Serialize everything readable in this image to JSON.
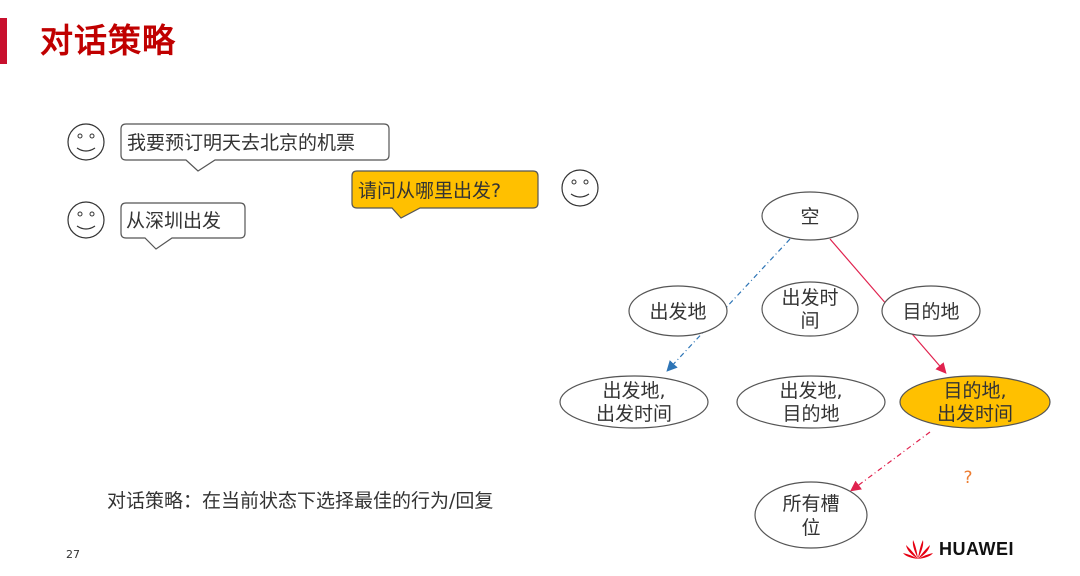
{
  "slide": {
    "title": "对话策略",
    "caption": "对话策略：在当前状态下选择最佳的行为/回复",
    "page_number": "27",
    "brand": "HUAWEI"
  },
  "dialogue": {
    "user_1": "我要预订明天去北京的机票",
    "system_1": "请问从哪里出发?",
    "user_2": "从深圳出发"
  },
  "tree": {
    "root": "空",
    "level1": [
      {
        "lines": [
          "出发地"
        ]
      },
      {
        "lines": [
          "出发时",
          "间"
        ]
      },
      {
        "lines": [
          "目的地"
        ]
      }
    ],
    "level2": [
      {
        "lines": [
          "出发地,",
          "出发时间"
        ]
      },
      {
        "lines": [
          "出发地,",
          "目的地"
        ]
      },
      {
        "lines": [
          "目的地,",
          "出发时间"
        ]
      }
    ],
    "final": {
      "lines": [
        "所有槽",
        "位"
      ]
    },
    "question_mark": "?"
  },
  "colors": {
    "highlight": "#ffc000",
    "blue_arrow": "#2e75b6",
    "red_arrow": "#e0224e",
    "title": "#c00000"
  }
}
